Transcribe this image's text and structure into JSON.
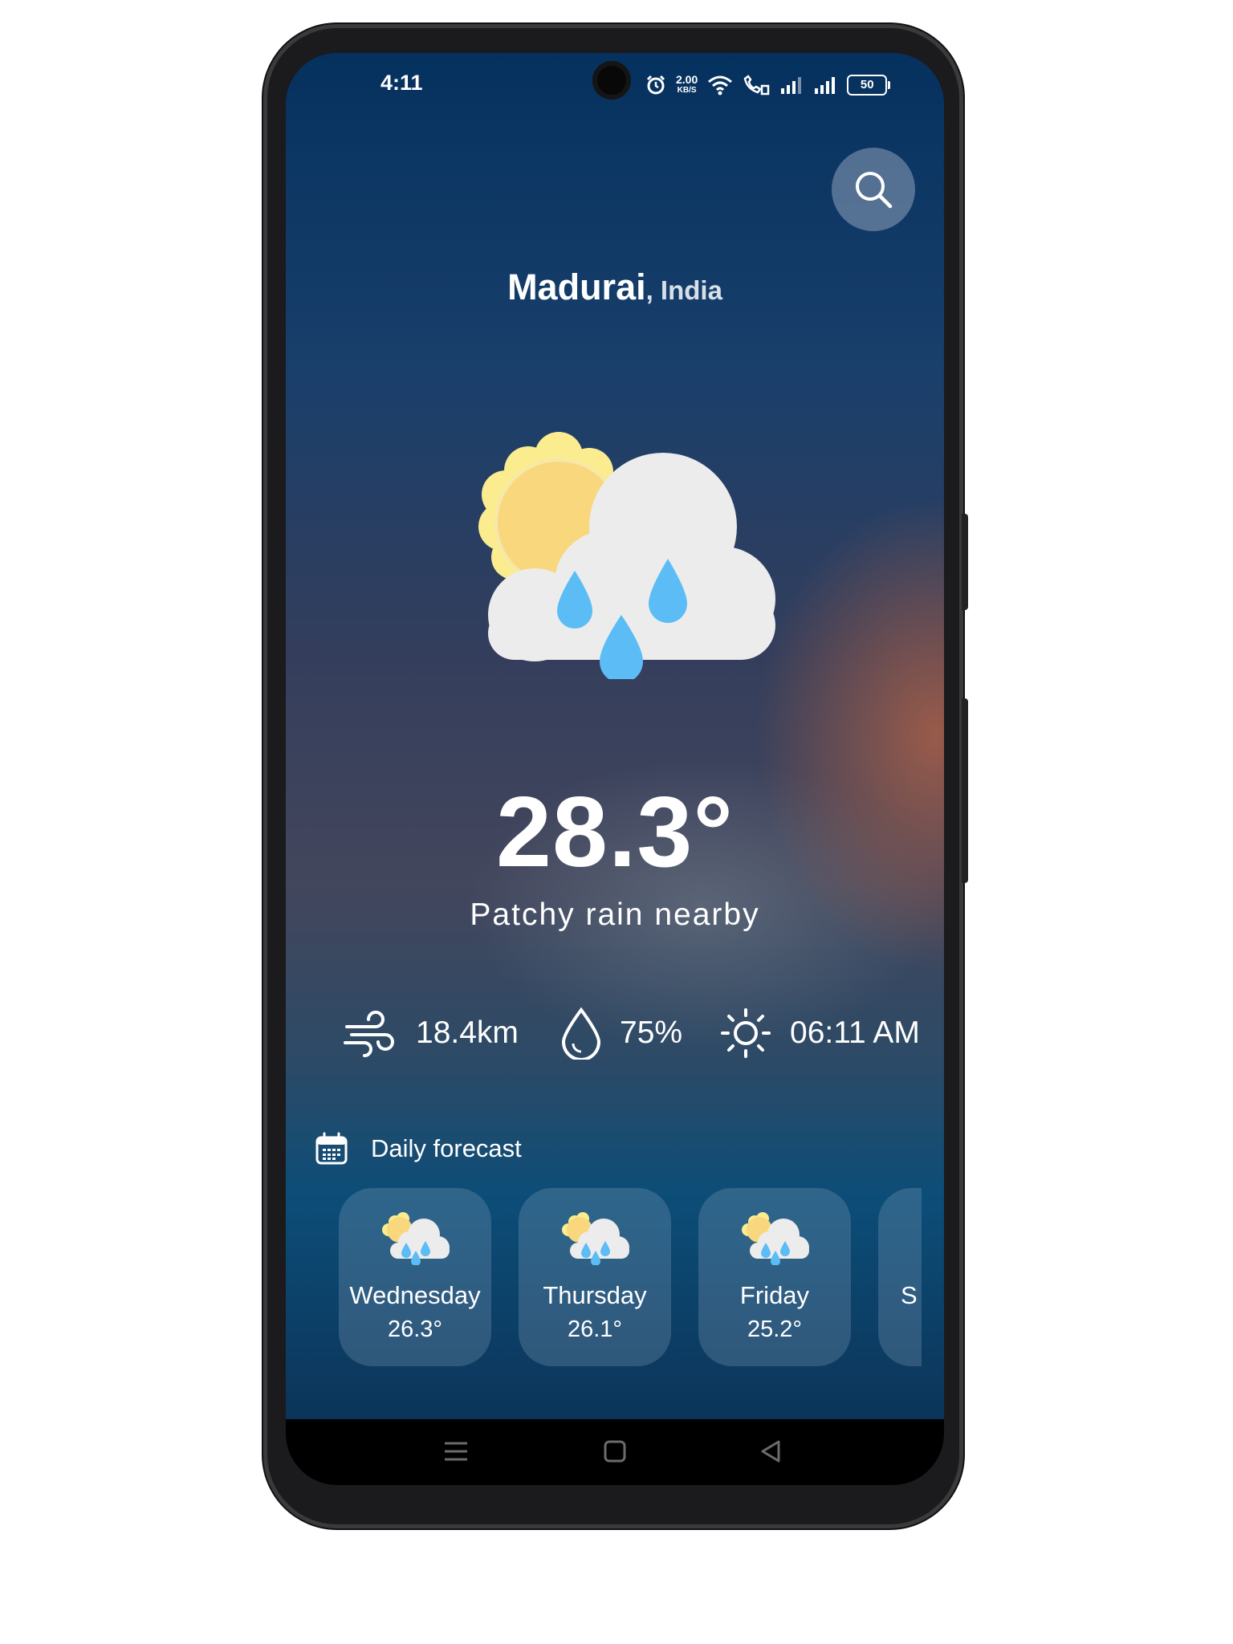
{
  "status_bar": {
    "time": "4:11",
    "net_speed": "2.00",
    "net_unit": "KB/S",
    "battery": "50",
    "icons": [
      "camera-icon",
      "alarm-icon",
      "wifi-icon",
      "wifi-call-icon",
      "signal-icon",
      "signal-icon",
      "battery-icon"
    ]
  },
  "search": {
    "icon": "search-icon"
  },
  "location": {
    "city": "Madurai",
    "country": ", India"
  },
  "current": {
    "icon": "partly-cloudy-rain-icon",
    "temperature": "28.3°",
    "condition": "Patchy rain nearby"
  },
  "stats": {
    "wind": {
      "icon": "wind-icon",
      "value": "18.4km"
    },
    "humidity": {
      "icon": "droplet-icon",
      "value": "75%"
    },
    "sunrise": {
      "icon": "sun-icon",
      "value": "06:11 AM"
    }
  },
  "forecast": {
    "title": "Daily forecast",
    "icon": "calendar-icon",
    "days": [
      {
        "day": "Wednesday",
        "temp": "26.3°",
        "icon": "partly-cloudy-rain-icon"
      },
      {
        "day": "Thursday",
        "temp": "26.1°",
        "icon": "partly-cloudy-rain-icon"
      },
      {
        "day": "Friday",
        "temp": "25.2°",
        "icon": "partly-cloudy-rain-icon"
      },
      {
        "day": "S",
        "temp": "",
        "icon": ""
      }
    ]
  },
  "nav": {
    "items": [
      "menu-icon",
      "home-icon",
      "back-icon"
    ]
  },
  "colors": {
    "accent_blue": "#5cbcf6",
    "cloud": "#ececec",
    "sun": "#f9d77d",
    "sun_halo": "#fbec8f"
  }
}
